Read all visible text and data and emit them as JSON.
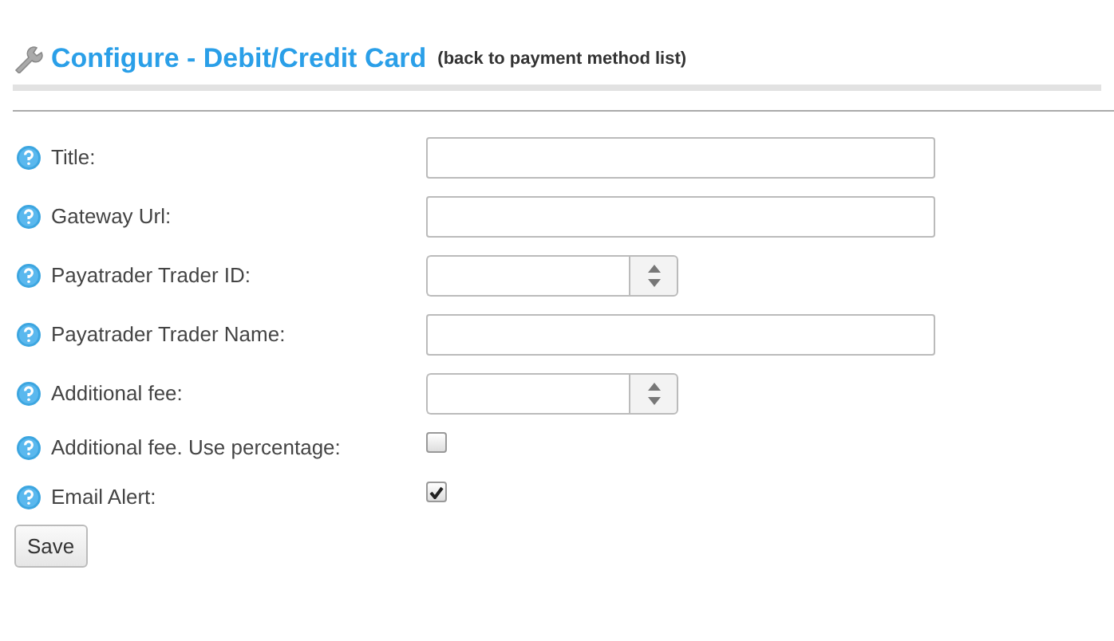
{
  "header": {
    "title": "Configure - Debit/Credit Card",
    "back_link": "(back to payment method list)"
  },
  "fields": [
    {
      "label": "Title:",
      "kind": "text"
    },
    {
      "label": "Gateway Url:",
      "kind": "text"
    },
    {
      "label": "Payatrader Trader ID:",
      "kind": "number"
    },
    {
      "label": "Payatrader Trader Name:",
      "kind": "text"
    },
    {
      "label": "Additional fee:",
      "kind": "number"
    },
    {
      "label": "Additional fee. Use percentage:",
      "kind": "checkbox",
      "checked": false
    },
    {
      "label": "Email Alert:",
      "kind": "checkbox",
      "checked": true
    }
  ],
  "save_button": "Save"
}
